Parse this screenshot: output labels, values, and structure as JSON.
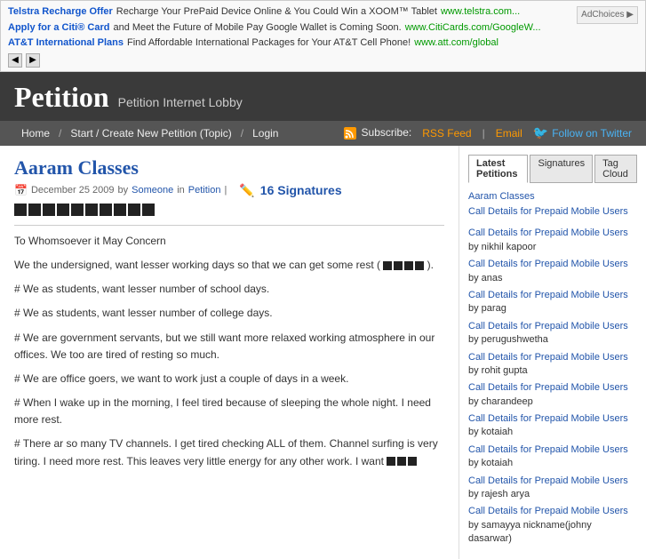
{
  "ad_banner": {
    "ads": [
      {
        "link_text": "Telstra Recharge Offer",
        "link_url": "#",
        "description": "Recharge Your PrePaid Device Online & You Could Win a XOOM™ Tablet",
        "url_display": "www.telstra.com..."
      },
      {
        "link_text": "Apply for a Citi® Card",
        "link_url": "#",
        "description": "and Meet the Future of Mobile Pay Google Wallet is Coming Soon.",
        "url_display": "www.CitiCards.com/GoogleW..."
      },
      {
        "link_text": "AT&T International Plans",
        "link_url": "#",
        "description": "Find Affordable International Packages for Your AT&T Cell Phone!",
        "url_display": "www.att.com/global"
      }
    ],
    "ad_choices_label": "AdChoices ▶"
  },
  "header": {
    "title": "Petition",
    "subtitle": "Petition Internet Lobby"
  },
  "nav": {
    "links": [
      "Home",
      "Start / Create New Petition (Topic)",
      "Login"
    ],
    "subscribe_label": "Subscribe:",
    "rss_label": "RSS Feed",
    "email_label": "Email",
    "follow_label": "Follow on Twitter"
  },
  "petition": {
    "title": "Aaram Classes",
    "date": "December 25 2009",
    "author": "Someone",
    "category": "Petition",
    "signatures_count": "16 Signatures",
    "body": {
      "salutation": "To Whomsoever it May Concern",
      "intro": "We the undersigned, want lesser working days so that we can get some rest (",
      "points": [
        "# We as students, want lesser number of school days.",
        "# We as students, want lesser number of college days.",
        "# We are government servants, but we still want more relaxed working atmosphere in our offices. We too are tired of resting so much.",
        "# We are office goers, we want to work just a couple of days in a week.",
        "# When I wake up in the morning, I feel tired because of sleeping the whole night. I need more rest.",
        "# There ar so many TV channels. I get tired checking ALL of them. Channel surfing is very tiring. I need more rest. This leaves very little energy for any other work. I want"
      ]
    }
  },
  "sidebar": {
    "tabs": [
      "Latest Petitions",
      "Signatures",
      "Tag Cloud"
    ],
    "active_tab": "Latest Petitions",
    "top_petitions": [
      "Aaram Classes",
      "Call Details for Prepaid Mobile Users"
    ],
    "entries": [
      {
        "link": "Call Details for Prepaid Mobile Users",
        "by": "by nikhil kapoor"
      },
      {
        "link": "Call Details for Prepaid Mobile Users",
        "by": "by anas"
      },
      {
        "link": "Call Details for Prepaid Mobile Users",
        "by": "by parag"
      },
      {
        "link": "Call Details for Prepaid Mobile Users",
        "by": "by perugushwetha"
      },
      {
        "link": "Call Details for Prepaid Mobile Users",
        "by": "by rohit gupta"
      },
      {
        "link": "Call Details for Prepaid Mobile Users",
        "by": "by charandeep"
      },
      {
        "link": "Call Details for Prepaid Mobile Users",
        "by": "by kotaiah"
      },
      {
        "link": "Call Details for Prepaid Mobile Users",
        "by": "by kotaiah"
      },
      {
        "link": "Call Details for Prepaid Mobile Users",
        "by": "by rajesh arya"
      },
      {
        "link": "Call Details for Prepaid Mobile Users",
        "by": "by samayya nickname(johny dasarwar)"
      }
    ]
  }
}
